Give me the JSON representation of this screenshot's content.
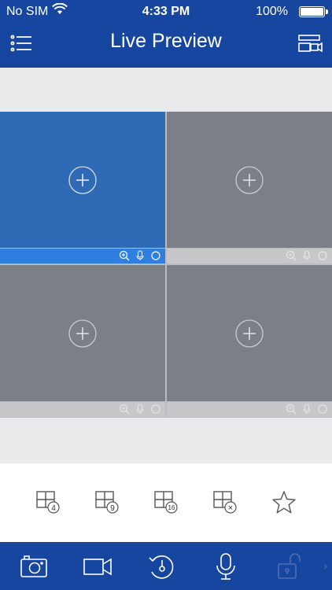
{
  "status": {
    "carrier": "No SIM",
    "time": "4:33 PM",
    "battery": "100%"
  },
  "nav": {
    "title": "Live Preview",
    "left_icon": "list-menu-icon",
    "right_icon": "window-camera-icon"
  },
  "grid": {
    "cells": [
      {
        "state": "active",
        "add_icon": "add-channel-icon",
        "controls": [
          "zoom-icon",
          "mic-icon",
          "circle-icon"
        ]
      },
      {
        "state": "idle",
        "add_icon": "add-channel-icon",
        "controls": [
          "zoom-icon",
          "mic-icon",
          "circle-icon"
        ]
      },
      {
        "state": "idle",
        "add_icon": "add-channel-icon",
        "controls": [
          "zoom-icon",
          "mic-icon",
          "circle-icon"
        ]
      },
      {
        "state": "idle",
        "add_icon": "add-channel-icon",
        "controls": [
          "zoom-icon",
          "mic-icon",
          "circle-icon"
        ]
      }
    ]
  },
  "layout_bar": {
    "items": [
      {
        "name": "layout-4",
        "badge": "4"
      },
      {
        "name": "layout-9",
        "badge": "9"
      },
      {
        "name": "layout-16",
        "badge": "16"
      },
      {
        "name": "layout-close",
        "badge": "×"
      },
      {
        "name": "favorite",
        "badge": ""
      }
    ]
  },
  "toolbar": {
    "items": [
      "snapshot-icon",
      "record-icon",
      "playback-icon",
      "talk-icon",
      "unlock-icon"
    ],
    "more": "›"
  },
  "colors": {
    "header": "#1746a0",
    "active_cell": "#2e6ab6",
    "active_ctrl": "#2f7fe0",
    "idle_cell": "#7b8088"
  }
}
